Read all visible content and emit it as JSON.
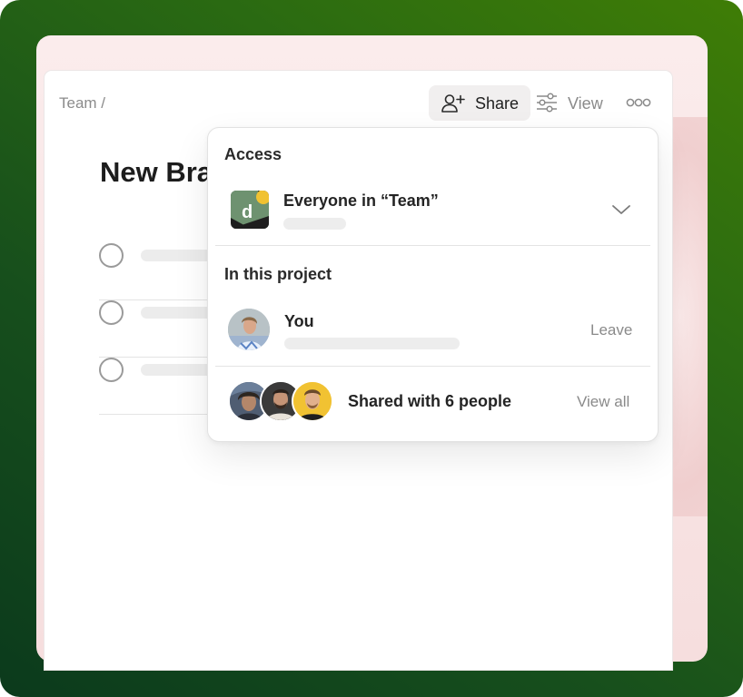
{
  "breadcrumb": {
    "label": "Team /"
  },
  "toolbar": {
    "share_label": "Share",
    "view_label": "View",
    "share_icon": "add-person-icon",
    "view_icon": "sliders-icon",
    "more_icon": "more-dots-icon"
  },
  "page": {
    "title": "New Bra"
  },
  "popover": {
    "access_title": "Access",
    "team": {
      "name": "Everyone in “Team”",
      "logo_letter": "d",
      "logo_colors": [
        "#6e9270",
        "#1e1e1e",
        "#f1c232"
      ]
    },
    "project_title": "In this project",
    "you": {
      "name": "You",
      "action": "Leave"
    },
    "shared": {
      "label": "Shared with 6 people",
      "action": "View all"
    }
  }
}
